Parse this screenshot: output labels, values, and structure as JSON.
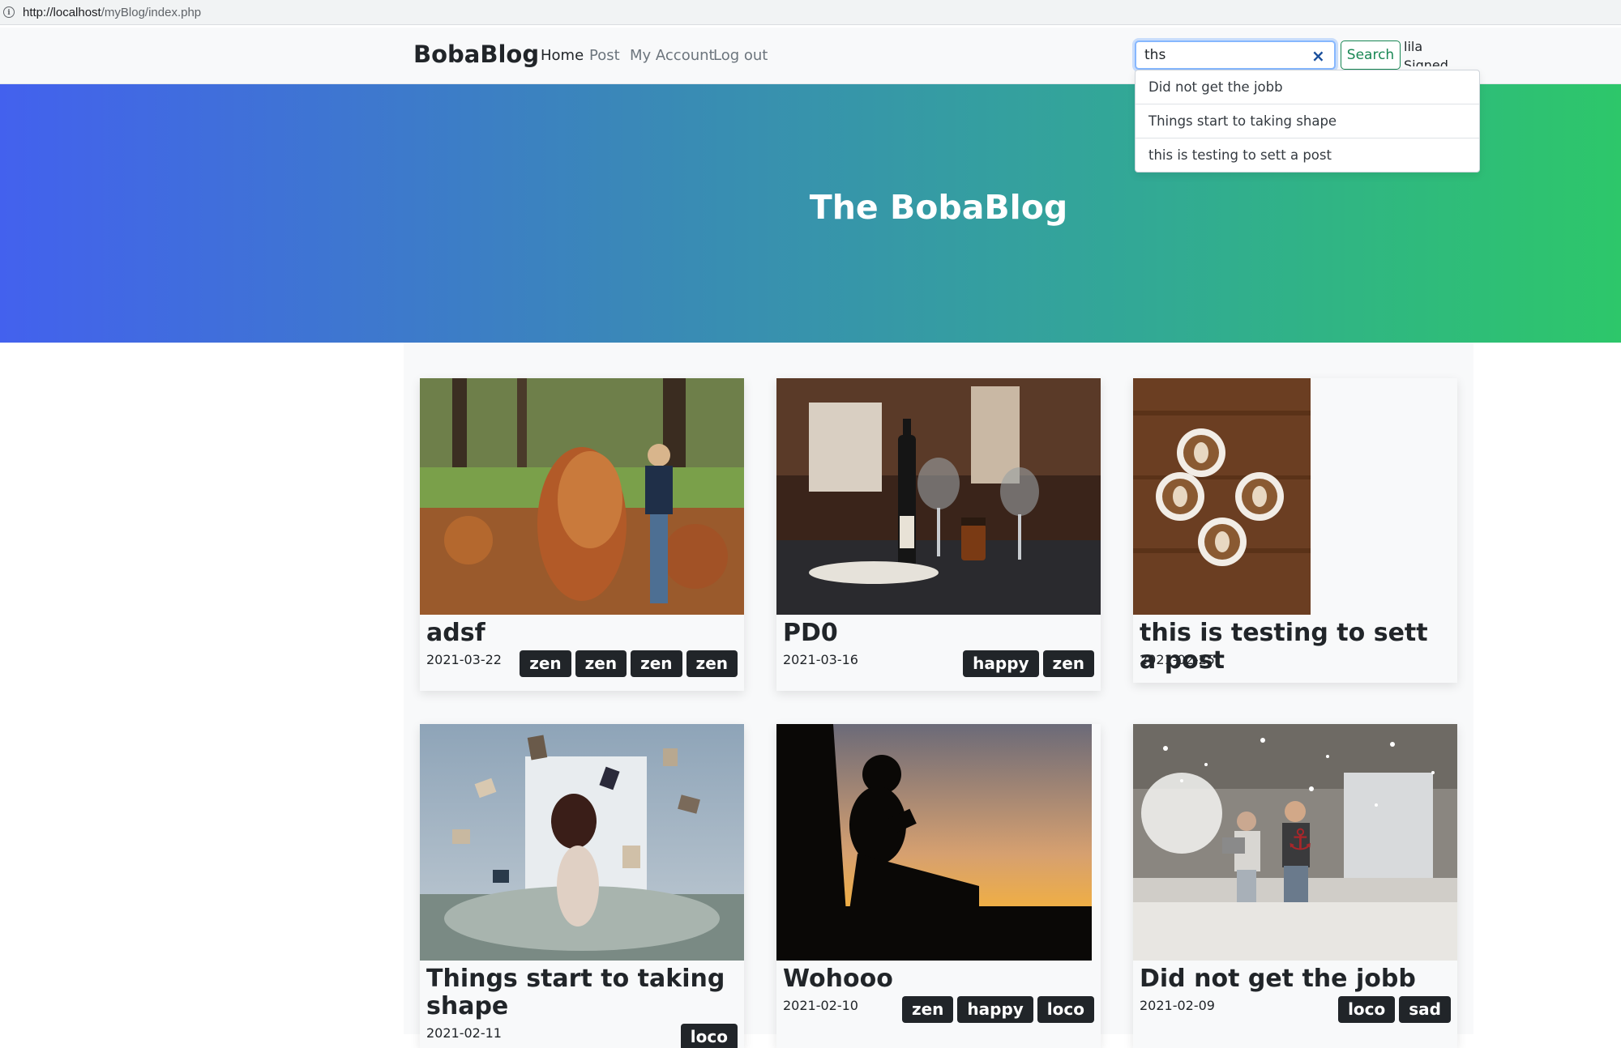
{
  "browser": {
    "url_host": "http://localhost",
    "url_path": "/myBlog/index.php"
  },
  "navbar": {
    "brand": "BobaBlog",
    "links": [
      "Home",
      "Post",
      "My Account",
      "Log out"
    ],
    "search": {
      "value": "ths",
      "button": "Search",
      "clear_icon": "×"
    },
    "user": {
      "name": "lila",
      "status": "Signed in"
    }
  },
  "suggestions": [
    "Did not get the jobb",
    "Things start to taking shape",
    "this is testing to sett a post"
  ],
  "hero": {
    "title": "The BobaBlog"
  },
  "posts": [
    {
      "title": "adsf",
      "date": "2021-03-22",
      "tags": [
        "zen",
        "zen",
        "zen",
        "zen"
      ],
      "image": "child-autumn-leaves-photo"
    },
    {
      "title": "PD0",
      "date": "2021-03-16",
      "tags": [
        "happy",
        "zen"
      ],
      "image": "wine-bottle-glasses-table-photo"
    },
    {
      "title": "this is testing to sett a post",
      "date": "2021-02-25",
      "tags": [],
      "image": "latte-art-cups-photo"
    },
    {
      "title": "Things start to taking shape",
      "date": "2021-02-11",
      "tags": [
        "loco"
      ],
      "image": "woman-flying-books-photo"
    },
    {
      "title": "Wohooo",
      "date": "2021-02-10",
      "tags": [
        "zen",
        "happy",
        "loco"
      ],
      "image": "boy-reading-sunset-silhouette-photo"
    },
    {
      "title": "Did not get the jobb",
      "date": "2021-02-09",
      "tags": [
        "loco",
        "sad"
      ],
      "image": "kids-pillow-fight-photo"
    }
  ],
  "colors": {
    "hero_gradient": [
      "#4361ee",
      "#3a87b9",
      "#32a896",
      "#2dc76a"
    ],
    "tag_bg": "#212529",
    "search_button": "#198754",
    "focus_ring": "#86b7fe"
  }
}
